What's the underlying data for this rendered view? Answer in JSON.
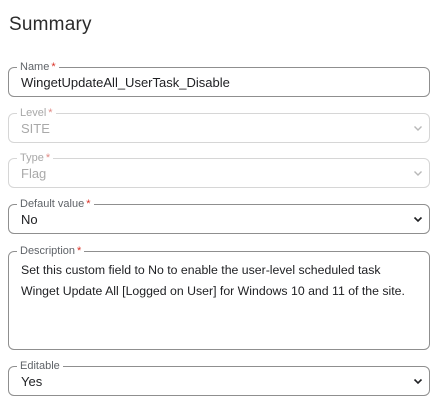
{
  "summary": {
    "title": "Summary"
  },
  "fields": {
    "name": {
      "label": "Name",
      "required": "*",
      "value": "WingetUpdateAll_UserTask_Disable"
    },
    "level": {
      "label": "Level",
      "required": "*",
      "value": "SITE",
      "icon": "chevron-down-icon"
    },
    "type": {
      "label": "Type",
      "required": "*",
      "value": "Flag",
      "icon": "chevron-down-icon"
    },
    "default_value": {
      "label": "Default value",
      "required": "*",
      "value": "No",
      "icon": "chevron-down-icon"
    },
    "description": {
      "label": "Description",
      "required": "*",
      "value": "Set this custom field to No to enable the user-level scheduled task Winget Update All [Logged on User] for Windows 10 and 11 of the site."
    },
    "editable": {
      "label": "Editable",
      "value": "Yes",
      "icon": "chevron-down-icon"
    }
  },
  "colors": {
    "required": "#d93025",
    "border": "#8f8f8f",
    "disabled_border": "#d6d6d6"
  }
}
